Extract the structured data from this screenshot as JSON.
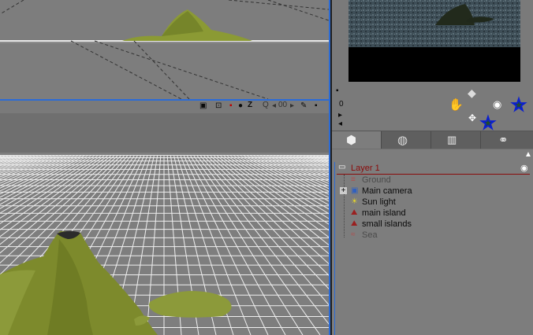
{
  "viewport_top": {
    "name": "top-view"
  },
  "viewport_bar": {
    "zoom_value": "00",
    "zoom_letter": "Z",
    "q_label": "Q"
  },
  "preview_controls": {
    "counter": "0"
  },
  "tabs": [
    "objects",
    "materials",
    "layers",
    "links"
  ],
  "tree": {
    "layer": "Layer 1",
    "items": [
      {
        "label": "Ground",
        "icon": "ground-icon",
        "muted": true
      },
      {
        "label": "Main camera",
        "icon": "camera-icon",
        "muted": false
      },
      {
        "label": "Sun light",
        "icon": "light-icon",
        "muted": false
      },
      {
        "label": "main island",
        "icon": "terrain-icon",
        "muted": false
      },
      {
        "label": "small islands",
        "icon": "terrain-icon",
        "muted": false
      },
      {
        "label": "Sea",
        "icon": "water-icon",
        "muted": true
      }
    ]
  },
  "colors": {
    "accent_blue": "#2b6bd6",
    "layer_red": "#8a0a0a",
    "grid_white": "#ffffff",
    "terrain_green": "#7f8f2a"
  }
}
